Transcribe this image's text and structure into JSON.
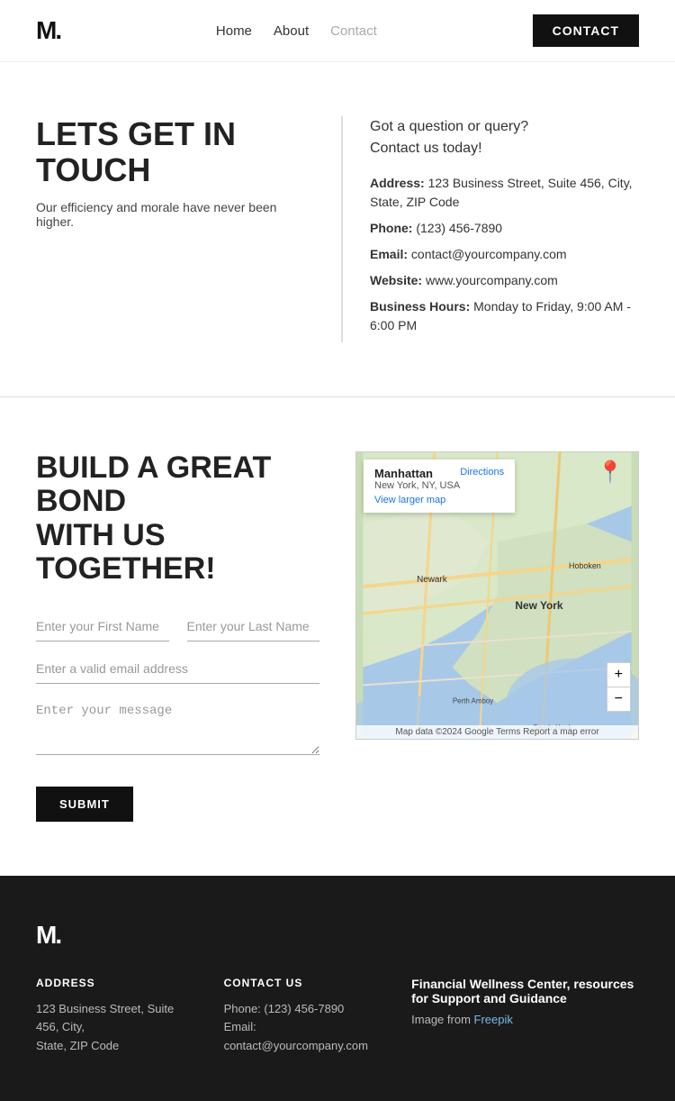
{
  "nav": {
    "logo": "M.",
    "links": [
      "Home",
      "About",
      "Contact"
    ],
    "active_link": "Contact",
    "contact_btn": "CONTACT"
  },
  "section1": {
    "title": "LETS GET IN TOUCH",
    "subtitle": "Our efficiency and morale have never been higher.",
    "query_line1": "Got a question or query?",
    "query_line2": "Contact us today!",
    "address_label": "Address:",
    "address_value": "123 Business Street, Suite 456, City, State, ZIP Code",
    "phone_label": "Phone:",
    "phone_value": "(123) 456-7890",
    "email_label": "Email:",
    "email_value": "contact@yourcompany.com",
    "website_label": "Website:",
    "website_value": "www.yourcompany.com",
    "hours_label": "Business Hours:",
    "hours_value": "Monday to Friday, 9:00 AM - 6:00 PM"
  },
  "section2": {
    "title_line1": "BUILD A GREAT BOND",
    "title_line2": "WITH US TOGETHER!",
    "first_name_placeholder": "Enter your First Name",
    "last_name_placeholder": "Enter your Last Name",
    "email_placeholder": "Enter a valid email address",
    "message_placeholder": "Enter your message",
    "submit_label": "SUBMIT",
    "map": {
      "location_name": "Manhattan",
      "location_sub": "New York, NY, USA",
      "directions_label": "Directions",
      "larger_map_label": "View larger map",
      "zoom_in": "+",
      "zoom_out": "−",
      "credit": "Map data ©2024 Google  Terms  Report a map error"
    }
  },
  "footer": {
    "logo": "M.",
    "address_title": "ADDRESS",
    "address_line1": "123 Business Street, Suite 456, City,",
    "address_line2": "State, ZIP Code",
    "contact_title": "CONTACT US",
    "contact_phone": "Phone: (123) 456-7890",
    "contact_email": "Email: contact@yourcompany.com",
    "fin_title": "Financial Wellness Center, resources for Support and Guidance",
    "fin_image_text": "Image from",
    "fin_image_link": "Freepik"
  }
}
